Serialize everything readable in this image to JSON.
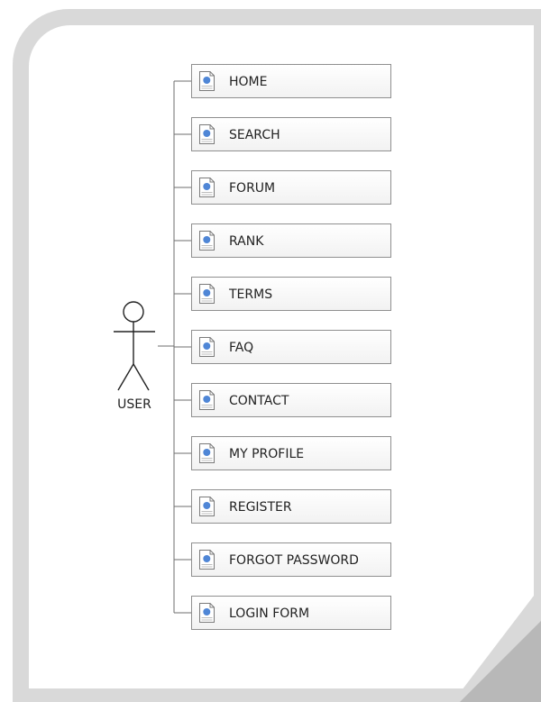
{
  "actor": {
    "label": "USER",
    "icon": "stick-figure-actor-icon"
  },
  "use_cases": [
    {
      "label": "HOME",
      "icon": "document-icon"
    },
    {
      "label": "SEARCH",
      "icon": "document-icon"
    },
    {
      "label": "FORUM",
      "icon": "document-icon"
    },
    {
      "label": "RANK",
      "icon": "document-icon"
    },
    {
      "label": "TERMS",
      "icon": "document-icon"
    },
    {
      "label": "FAQ",
      "icon": "document-icon"
    },
    {
      "label": "CONTACT",
      "icon": "document-icon"
    },
    {
      "label": "MY PROFILE",
      "icon": "document-icon"
    },
    {
      "label": "REGISTER",
      "icon": "document-icon"
    },
    {
      "label": "FORGOT PASSWORD",
      "icon": "document-icon"
    },
    {
      "label": "LOGIN FORM",
      "icon": "document-icon"
    }
  ],
  "colors": {
    "node_border": "#8f8f8f",
    "connector": "#6e6e6e",
    "doc_circle": "#4f86d6"
  }
}
